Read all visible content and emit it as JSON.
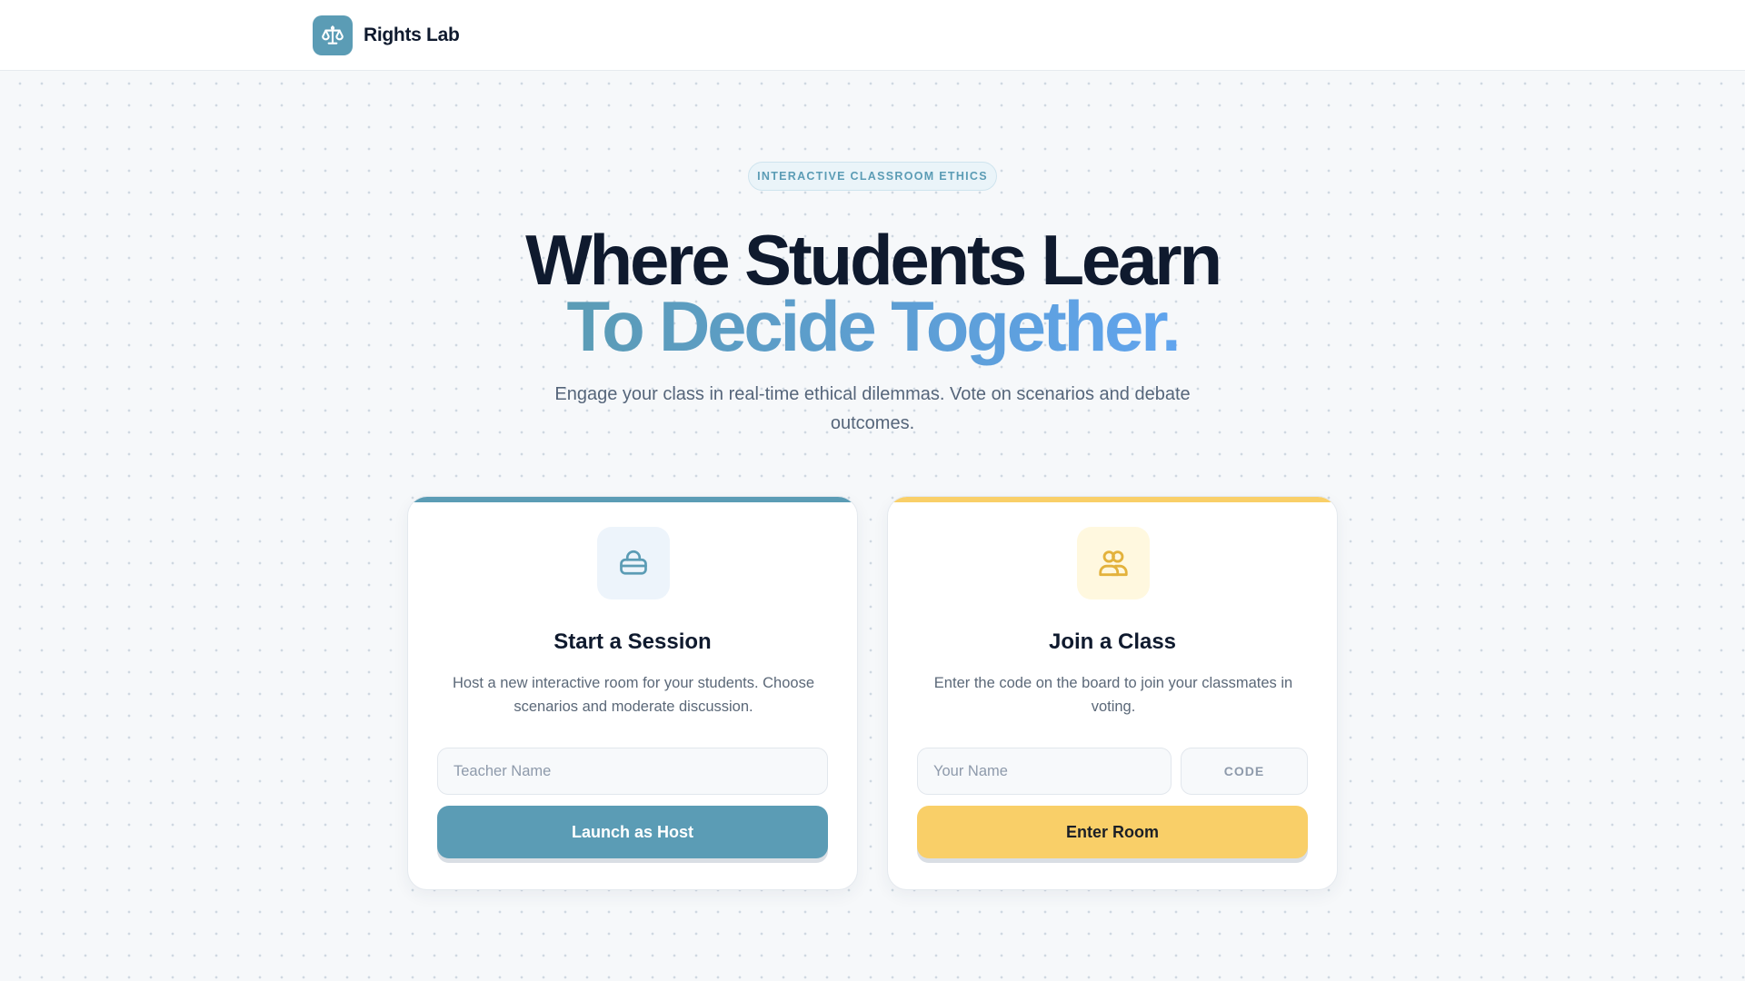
{
  "brand": {
    "name": "Rights Lab",
    "logo_icon": "scale-icon"
  },
  "hero": {
    "badge": "INTERACTIVE CLASSROOM ETHICS",
    "headline_line1": "Where Students Learn",
    "headline_line2": "To Decide Together.",
    "subtitle": "Engage your class in real-time ethical dilemmas. Vote on scenarios and debate outcomes."
  },
  "host_card": {
    "icon": "host-desk-icon",
    "title": "Start a Session",
    "description": "Host a new interactive room for your students. Choose scenarios and moderate discussion.",
    "name_placeholder": "Teacher Name",
    "button_label": "Launch as Host",
    "accent_color": "#5b9cb5"
  },
  "join_card": {
    "icon": "users-icon",
    "title": "Join a Class",
    "description": "Enter the code on the board to join your classmates in voting.",
    "name_placeholder": "Your Name",
    "code_placeholder": "CODE",
    "button_label": "Enter Room",
    "accent_color": "#f9cf68"
  }
}
